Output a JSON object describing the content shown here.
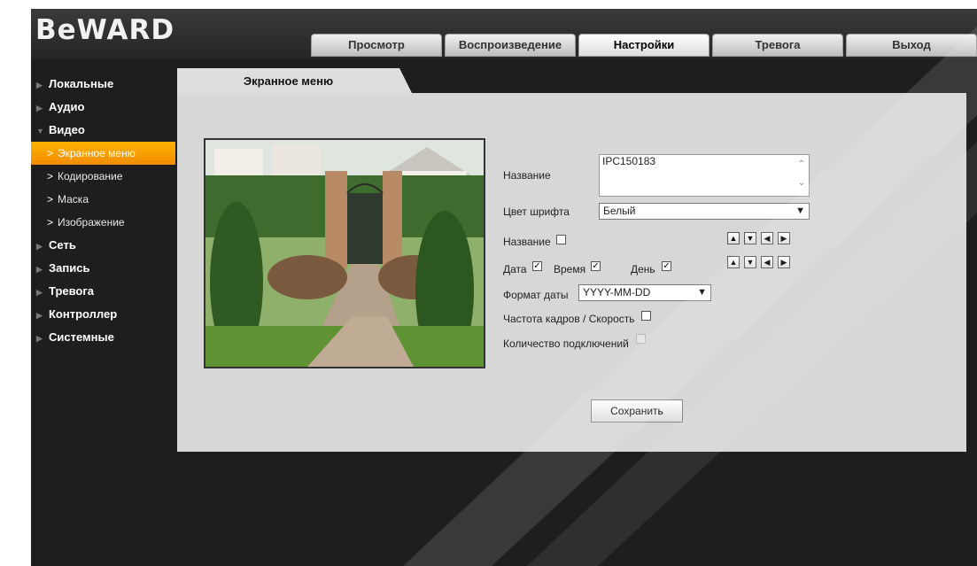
{
  "brand": {
    "logo_text": "BeWARD"
  },
  "nav": {
    "tabs": [
      {
        "label": "Просмотр"
      },
      {
        "label": "Воспроизведение"
      },
      {
        "label": "Настройки"
      },
      {
        "label": "Тревога"
      },
      {
        "label": "Выход"
      }
    ],
    "active_tab": "Настройки"
  },
  "sidebar": {
    "items": [
      {
        "label": "Локальные"
      },
      {
        "label": "Аудио"
      },
      {
        "label": "Видео",
        "expanded": true
      },
      {
        "label": "Сеть"
      },
      {
        "label": "Запись"
      },
      {
        "label": "Тревога"
      },
      {
        "label": "Контроллер"
      },
      {
        "label": "Системные"
      }
    ],
    "subitems": [
      {
        "label": "Экранное меню",
        "active": true
      },
      {
        "label": "Кодирование"
      },
      {
        "label": "Маска"
      },
      {
        "label": "Изображение"
      }
    ]
  },
  "panel": {
    "tab_label": "Экранное меню",
    "name_label": "Название",
    "name_value": "IPC150183",
    "font_color_label": "Цвет шрифта",
    "font_color_value": "Белый",
    "show_name_label": "Название",
    "show_name_checked": false,
    "date_label": "Дата",
    "date_checked": true,
    "time_label": "Время",
    "time_checked": true,
    "day_label": "День",
    "day_checked": true,
    "date_format_label": "Формат даты",
    "date_format_value": "YYYY-MM-DD",
    "framerate_label": "Частота кадров / Скорость",
    "framerate_checked": false,
    "connections_label": "Количество подключений",
    "connections_checked": false,
    "connections_disabled": true,
    "save_label": "Сохранить"
  },
  "icons": {
    "position_arrows": [
      "arrow-up-icon",
      "arrow-down-icon",
      "arrow-left-icon",
      "arrow-right-icon"
    ]
  },
  "colors": {
    "accent": "#f59a00",
    "background": "#1e1e1e",
    "panel": "#d7d7d7"
  }
}
